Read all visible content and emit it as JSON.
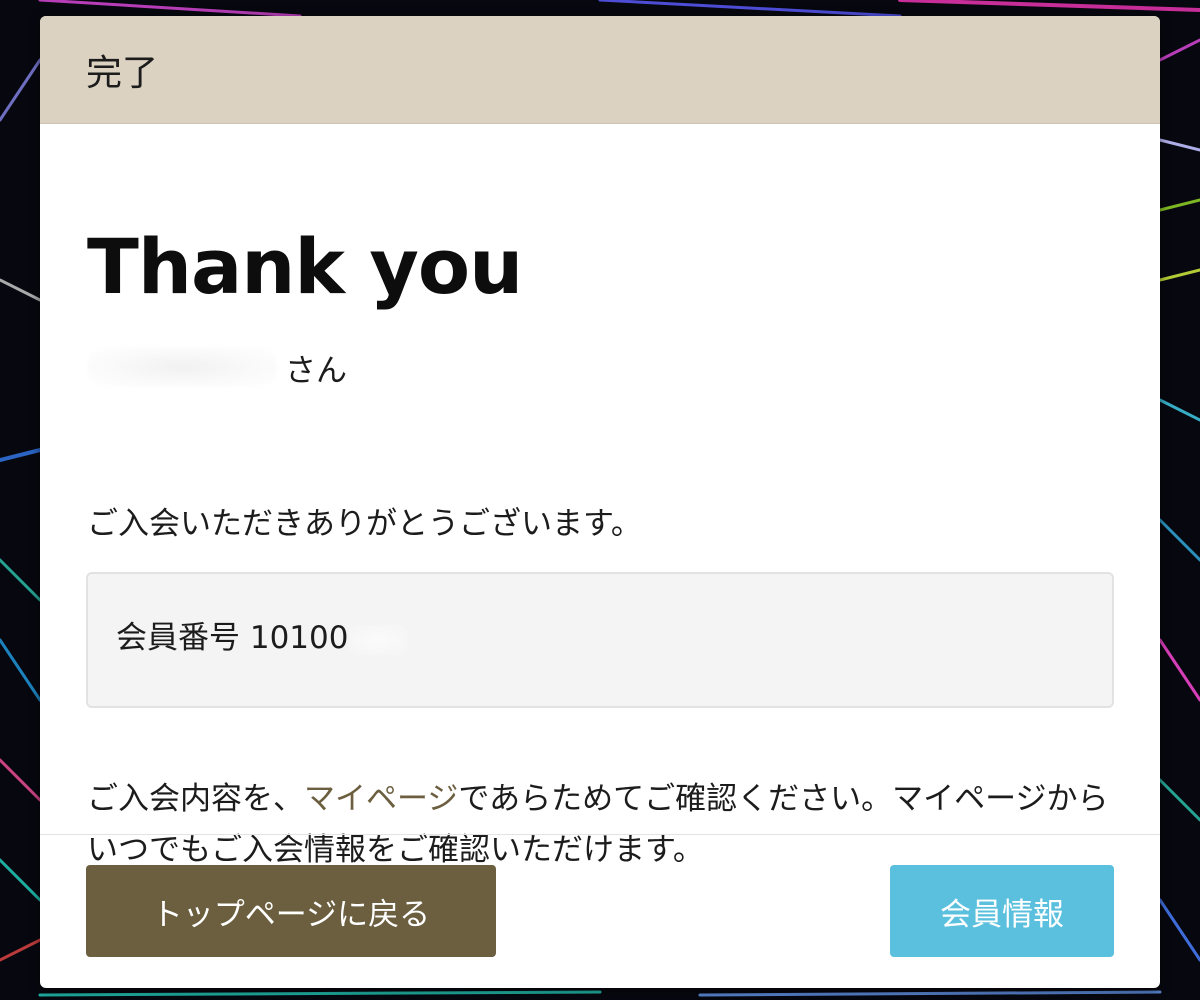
{
  "modal": {
    "title": "完了",
    "heading": "Thank you",
    "name_suffix": "さん",
    "thanks_message": "ご入会いただきありがとうございます。",
    "member_number_label": "会員番号 10100",
    "info_before_link": "ご入会内容を、",
    "info_link": "マイページ",
    "info_after_link": "であらためてご確認ください。マイページからいつでもご入会情報をご確認いただけます。",
    "buttons": {
      "top_page": "トップページに戻る",
      "member_info": "会員情報"
    }
  },
  "colors": {
    "header_bg": "#dcd2c2",
    "primary_button": "#6b5f3f",
    "info_button": "#5bc0de",
    "link": "#6b5f3f"
  },
  "background": {
    "description_icon": "fireworks-background"
  }
}
